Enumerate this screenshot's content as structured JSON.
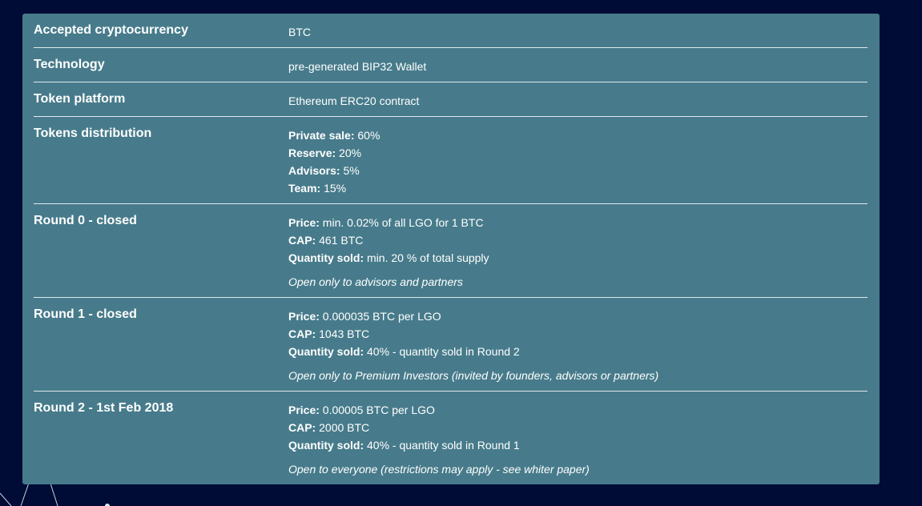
{
  "rows": [
    {
      "label": "Accepted cryptocurrency",
      "value": "BTC"
    },
    {
      "label": "Technology",
      "value": "pre-generated BIP32 Wallet"
    },
    {
      "label": "Token platform",
      "value": "Ethereum ERC20 contract"
    },
    {
      "label": "Tokens distribution",
      "lines": [
        {
          "k": "Private sale:",
          "v": " 60%"
        },
        {
          "k": "Reserve:",
          "v": " 20%"
        },
        {
          "k": "Advisors:",
          "v": " 5%"
        },
        {
          "k": "Team:",
          "v": " 15%"
        }
      ]
    },
    {
      "label": "Round 0 - closed",
      "lines": [
        {
          "k": "Price:",
          "v": " min. 0.02% of all LGO for 1 BTC"
        },
        {
          "k": "CAP:",
          "v": " 461 BTC"
        },
        {
          "k": "Quantity sold:",
          "v": " min. 20 % of total supply"
        }
      ],
      "note": "Open only to advisors and partners"
    },
    {
      "label": "Round 1 - closed",
      "lines": [
        {
          "k": "Price:",
          "v": " 0.000035 BTC per LGO"
        },
        {
          "k": "CAP:",
          "v": " 1043 BTC"
        },
        {
          "k": "Quantity sold:",
          "v": " 40% - quantity sold in Round 2"
        }
      ],
      "note": "Open only to Premium Investors (invited by founders, advisors or partners)"
    },
    {
      "label": "Round 2 - 1st Feb 2018",
      "lines": [
        {
          "k": "Price:",
          "v": " 0.00005 BTC per LGO"
        },
        {
          "k": "CAP:",
          "v": " 2000 BTC"
        },
        {
          "k": "Quantity sold:",
          "v": " 40% - quantity sold in Round 1"
        }
      ],
      "note": "Open to everyone (restrictions may apply - see whiter paper)"
    }
  ],
  "colors": {
    "background": "#000b36",
    "panel": "#477b8b",
    "text": "#ffffff",
    "divider": "#dfe9ec"
  }
}
